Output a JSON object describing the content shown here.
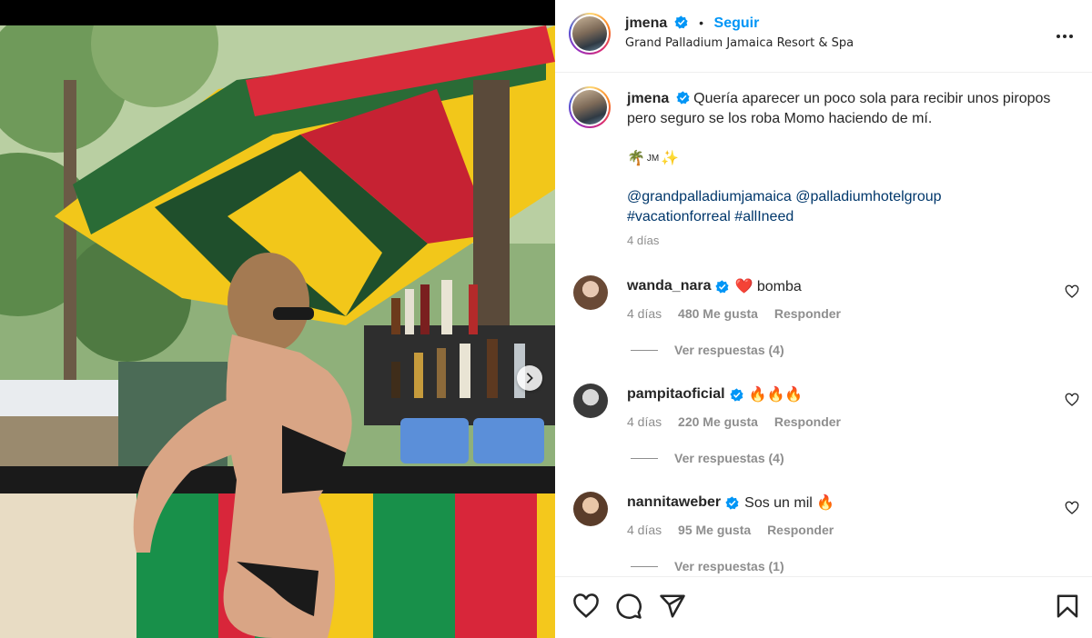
{
  "post": {
    "username": "jmena",
    "dot": "•",
    "follow_label": "Seguir",
    "location": "Grand Palladium Jamaica Resort & Spa"
  },
  "caption": {
    "username": "jmena",
    "text": "Quería aparecer un poco sola para recibir unos piropos pero seguro se los roba Momo haciendo de mí.",
    "emoji_line": {
      "palm": "🌴",
      "jm": "JM",
      "sparkle": "✨"
    },
    "mentions_line1": "@grandpalladiumjamaica @palladiumhotelgroup",
    "mentions_line2": "#vacationforreal #allIneed",
    "time": "4 días"
  },
  "comments": [
    {
      "username": "wanda_nara",
      "text": "❤️ bomba",
      "time": "4 días",
      "likes": "480 Me gusta",
      "reply_label": "Responder",
      "view_replies": "Ver respuestas (4)"
    },
    {
      "username": "pampitaoficial",
      "text": "🔥🔥🔥",
      "time": "4 días",
      "likes": "220 Me gusta",
      "reply_label": "Responder",
      "view_replies": "Ver respuestas (4)"
    },
    {
      "username": "nannitaweber",
      "text": "Sos un mil 🔥",
      "time": "4 días",
      "likes": "95 Me gusta",
      "reply_label": "Responder",
      "view_replies": "Ver respuestas (1)"
    }
  ],
  "icons": {
    "verified": "verified-badge-icon",
    "more": "more-options-icon",
    "like": "heart-icon",
    "comment": "comment-icon",
    "share": "share-icon",
    "save": "bookmark-icon",
    "next": "chevron-right-icon"
  },
  "colors": {
    "follow": "#0095f6",
    "link": "#00376b",
    "verified": "#0095f6",
    "muted": "#8e8e8e"
  }
}
